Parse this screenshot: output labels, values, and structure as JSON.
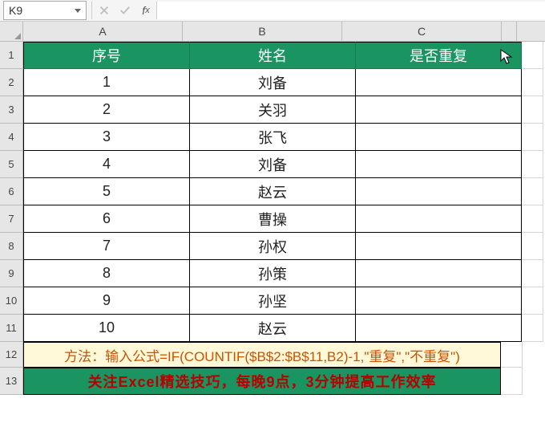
{
  "formula_bar": {
    "name_box_value": "K9",
    "formula_value": ""
  },
  "columns": [
    "A",
    "B",
    "C"
  ],
  "header_row": {
    "col_A": "序号",
    "col_B": "姓名",
    "col_C": "是否重复"
  },
  "row_numbers": [
    "1",
    "2",
    "3",
    "4",
    "5",
    "6",
    "7",
    "8",
    "9",
    "10",
    "11",
    "12",
    "13"
  ],
  "data_rows": [
    {
      "n": "1",
      "name": "刘备",
      "dup": ""
    },
    {
      "n": "2",
      "name": "关羽",
      "dup": ""
    },
    {
      "n": "3",
      "name": "张飞",
      "dup": ""
    },
    {
      "n": "4",
      "name": "刘备",
      "dup": ""
    },
    {
      "n": "5",
      "name": "赵云",
      "dup": ""
    },
    {
      "n": "6",
      "name": "曹操",
      "dup": ""
    },
    {
      "n": "7",
      "name": "孙权",
      "dup": ""
    },
    {
      "n": "8",
      "name": "孙策",
      "dup": ""
    },
    {
      "n": "9",
      "name": "孙坚",
      "dup": ""
    },
    {
      "n": "10",
      "name": "赵云",
      "dup": ""
    }
  ],
  "note_row": "方法：输入公式=IF(COUNTIF($B$2:$B$11,B2)-1,\"重复\",\"不重复\")",
  "banner_row": "关注Excel精选技巧，每晚9点，3分钟提高工作效率",
  "colors": {
    "header_bg": "#1a9461",
    "note_bg": "#fff9d9",
    "note_fg": "#c85300",
    "banner_fg": "#b80000"
  }
}
